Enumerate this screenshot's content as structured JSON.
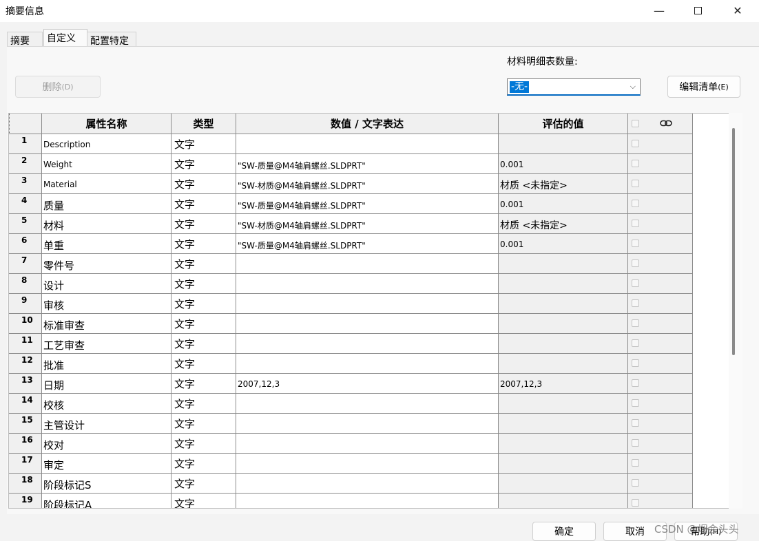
{
  "window": {
    "title": "摘要信息"
  },
  "tabs": [
    "摘要",
    "自定义",
    "配置特定"
  ],
  "toolbar": {
    "delete_label": "删除",
    "delete_shortcut": "(D)",
    "qty_label": "材料明细表数量:",
    "qty_value": "-无-",
    "edit_list_label": "编辑清单",
    "edit_list_shortcut": "(E)"
  },
  "table": {
    "headers": [
      "属性名称",
      "类型",
      "数值 / 文字表达",
      "评估的值"
    ],
    "rows": [
      {
        "num": "1",
        "name": "Description",
        "type": "文字",
        "value": "",
        "evaluated": ""
      },
      {
        "num": "2",
        "name": "Weight",
        "type": "文字",
        "value": "\"SW-质量@M4轴肩螺丝.SLDPRT\"",
        "evaluated": "0.001"
      },
      {
        "num": "3",
        "name": "Material",
        "type": "文字",
        "value": "\"SW-材质@M4轴肩螺丝.SLDPRT\"",
        "evaluated": "材质 <未指定>"
      },
      {
        "num": "4",
        "name": "质量",
        "type": "文字",
        "value": "\"SW-质量@M4轴肩螺丝.SLDPRT\"",
        "evaluated": "0.001"
      },
      {
        "num": "5",
        "name": "材料",
        "type": "文字",
        "value": "\"SW-材质@M4轴肩螺丝.SLDPRT\"",
        "evaluated": "材质 <未指定>"
      },
      {
        "num": "6",
        "name": "单重",
        "type": "文字",
        "value": "\"SW-质量@M4轴肩螺丝.SLDPRT\"",
        "evaluated": "0.001"
      },
      {
        "num": "7",
        "name": "零件号",
        "type": "文字",
        "value": "",
        "evaluated": ""
      },
      {
        "num": "8",
        "name": "设计",
        "type": "文字",
        "value": "",
        "evaluated": ""
      },
      {
        "num": "9",
        "name": "审核",
        "type": "文字",
        "value": "",
        "evaluated": ""
      },
      {
        "num": "10",
        "name": "标准审查",
        "type": "文字",
        "value": "",
        "evaluated": ""
      },
      {
        "num": "11",
        "name": "工艺审查",
        "type": "文字",
        "value": "",
        "evaluated": ""
      },
      {
        "num": "12",
        "name": "批准",
        "type": "文字",
        "value": "",
        "evaluated": ""
      },
      {
        "num": "13",
        "name": "日期",
        "type": "文字",
        "value": "2007,12,3",
        "evaluated": "2007,12,3"
      },
      {
        "num": "14",
        "name": "校核",
        "type": "文字",
        "value": "",
        "evaluated": ""
      },
      {
        "num": "15",
        "name": "主管设计",
        "type": "文字",
        "value": "",
        "evaluated": ""
      },
      {
        "num": "16",
        "name": "校对",
        "type": "文字",
        "value": "",
        "evaluated": ""
      },
      {
        "num": "17",
        "name": "审定",
        "type": "文字",
        "value": "",
        "evaluated": ""
      },
      {
        "num": "18",
        "name": "阶段标记S",
        "type": "文字",
        "value": "",
        "evaluated": ""
      },
      {
        "num": "19",
        "name": "阶段标记A",
        "type": "文字",
        "value": "",
        "evaluated": ""
      }
    ]
  },
  "footer": {
    "ok_label": "确定",
    "cancel_label": "取消",
    "help_label": "帮助",
    "help_shortcut": "(H)"
  },
  "watermark": "CSDN @烟会头头",
  "icons": {
    "link": "link-icon",
    "minimize": "minimize-icon",
    "maximize": "maximize-icon",
    "close": "close-icon",
    "dropdown": "chevron-down-icon"
  },
  "colors": {
    "selection": "#0078d7",
    "focus_underline": "#0067c0"
  }
}
